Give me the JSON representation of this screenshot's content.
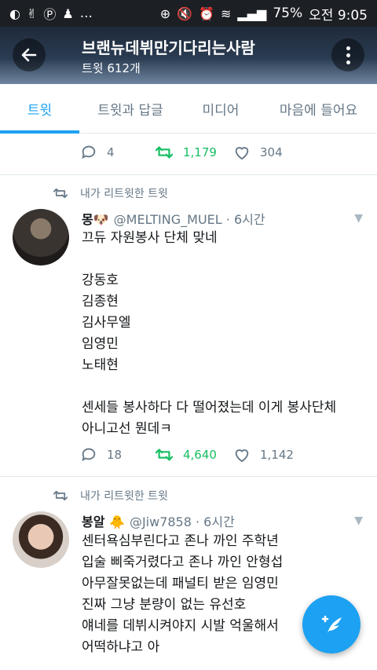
{
  "status_bar": {
    "icons_left": [
      "app-icon",
      "peace-icon",
      "p-icon",
      "notification-icon",
      "more-notifications-icon"
    ],
    "more": "...",
    "battery": "75%",
    "time": "오전 9:05",
    "icons_right": [
      "add-icon",
      "mute-icon",
      "alarm-icon",
      "wifi-icon",
      "signal-icon"
    ]
  },
  "header": {
    "title": "브랜뉴데뷔만기다리는사람",
    "subtitle": "트윗 612개"
  },
  "tabs": [
    {
      "label": "트윗",
      "active": true
    },
    {
      "label": "트윗과 답글",
      "active": false
    },
    {
      "label": "미디어",
      "active": false
    },
    {
      "label": "마음에 들어요",
      "active": false
    }
  ],
  "top_tweet_actions": {
    "replies": "4",
    "retweets": "1,179",
    "likes": "304"
  },
  "tweets": [
    {
      "retweet_label": "내가 리트윗한 트윗",
      "name": "몽🐶",
      "handle": "@MELTING_MUEL · 6시간",
      "lines": [
        "끄듀 자원봉사 단체 맞네",
        "",
        "강동호",
        "김종현",
        "김사무엘",
        "임영민",
        "노태현",
        "",
        "센세들 봉사하다 다 떨어졌는데 이게 봉사단체",
        "아니고선 뭔데ㅋ"
      ],
      "replies": "18",
      "retweets": "4,640",
      "likes": "1,142"
    },
    {
      "retweet_label": "내가 리트윗한 트윗",
      "name": "봉알 🐥",
      "handle": "@Jiw7858 · 6시간",
      "lines": [
        "센터욕심부린다고 존나 까인 주학년",
        "입술 삐죽거렸다고 존나 까인 안형섭",
        "아무잘못없는데 패널티 받은 임영민",
        "진짜 그냥 분량이 없는 유선호",
        "얘네를 데뷔시켜야지 시발 억울해서",
        "어떡하냐고 아"
      ]
    }
  ],
  "colors": {
    "accent": "#1da1f2",
    "retweet": "#17bf63",
    "muted": "#657786"
  }
}
